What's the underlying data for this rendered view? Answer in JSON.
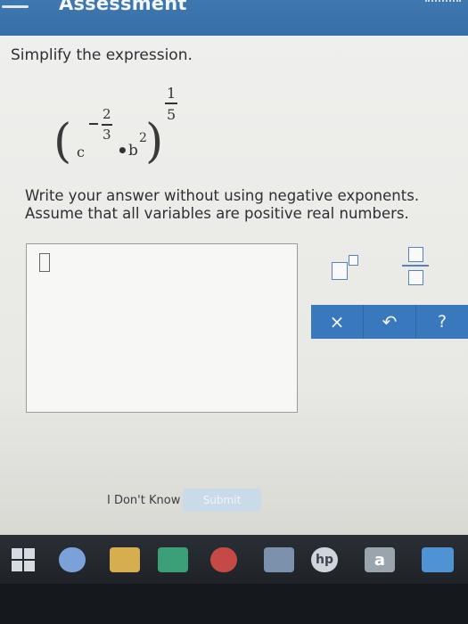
{
  "window": {
    "title": "Assessment"
  },
  "question": {
    "instruction": "Simplify the expression.",
    "expression": {
      "base1": "c",
      "exp1_sign": "−",
      "exp1_num": "2",
      "exp1_den": "3",
      "multiply": "•",
      "base2": "b",
      "exp2": "2",
      "outer_num": "1",
      "outer_den": "5"
    },
    "answer_instructions": [
      "Write your answer without using negative exponents.",
      "Assume that all variables are positive real numbers."
    ]
  },
  "toolbar": {
    "clear_label": "×",
    "undo_label": "↶",
    "help_label": "?"
  },
  "footer": {
    "dont_know_label": "I Don't Know",
    "submit_label": "Submit"
  },
  "taskbar": {
    "hp_label": "hp",
    "amazon_label": "a"
  },
  "colors": {
    "titlebar": "#3f78b0",
    "accent": "#3a78bd",
    "content_bg": "#efefed",
    "taskbar": "#2a2f35"
  }
}
